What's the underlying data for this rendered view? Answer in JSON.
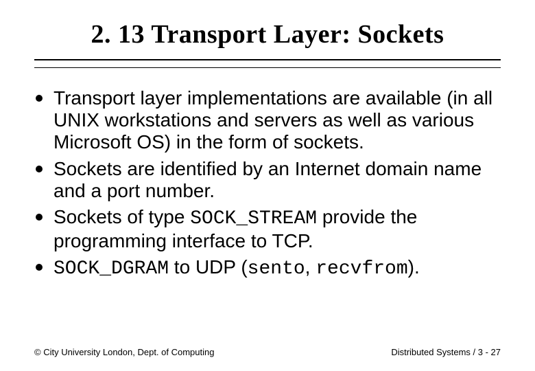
{
  "title": "2. 13 Transport Layer: Sockets",
  "bullets": [
    {
      "pre": "Transport layer implementations are available (in all UNIX workstations and servers as well as various Microsoft OS) in the form of sockets."
    },
    {
      "pre": "Sockets are identified by an Internet domain name and a port number."
    },
    {
      "pre": "Sockets of type ",
      "code1": "SOCK_STREAM",
      "mid": " provide the programming interface to TCP."
    },
    {
      "code1": "SOCK_DGRAM",
      "mid": " to UDP (",
      "code2": "sento",
      "mid2": ", ",
      "code3": "recvfrom",
      "post": ")."
    }
  ],
  "footer": {
    "left": "© City University London, Dept. of Computing",
    "right": "Distributed Systems / 3 - 27"
  }
}
